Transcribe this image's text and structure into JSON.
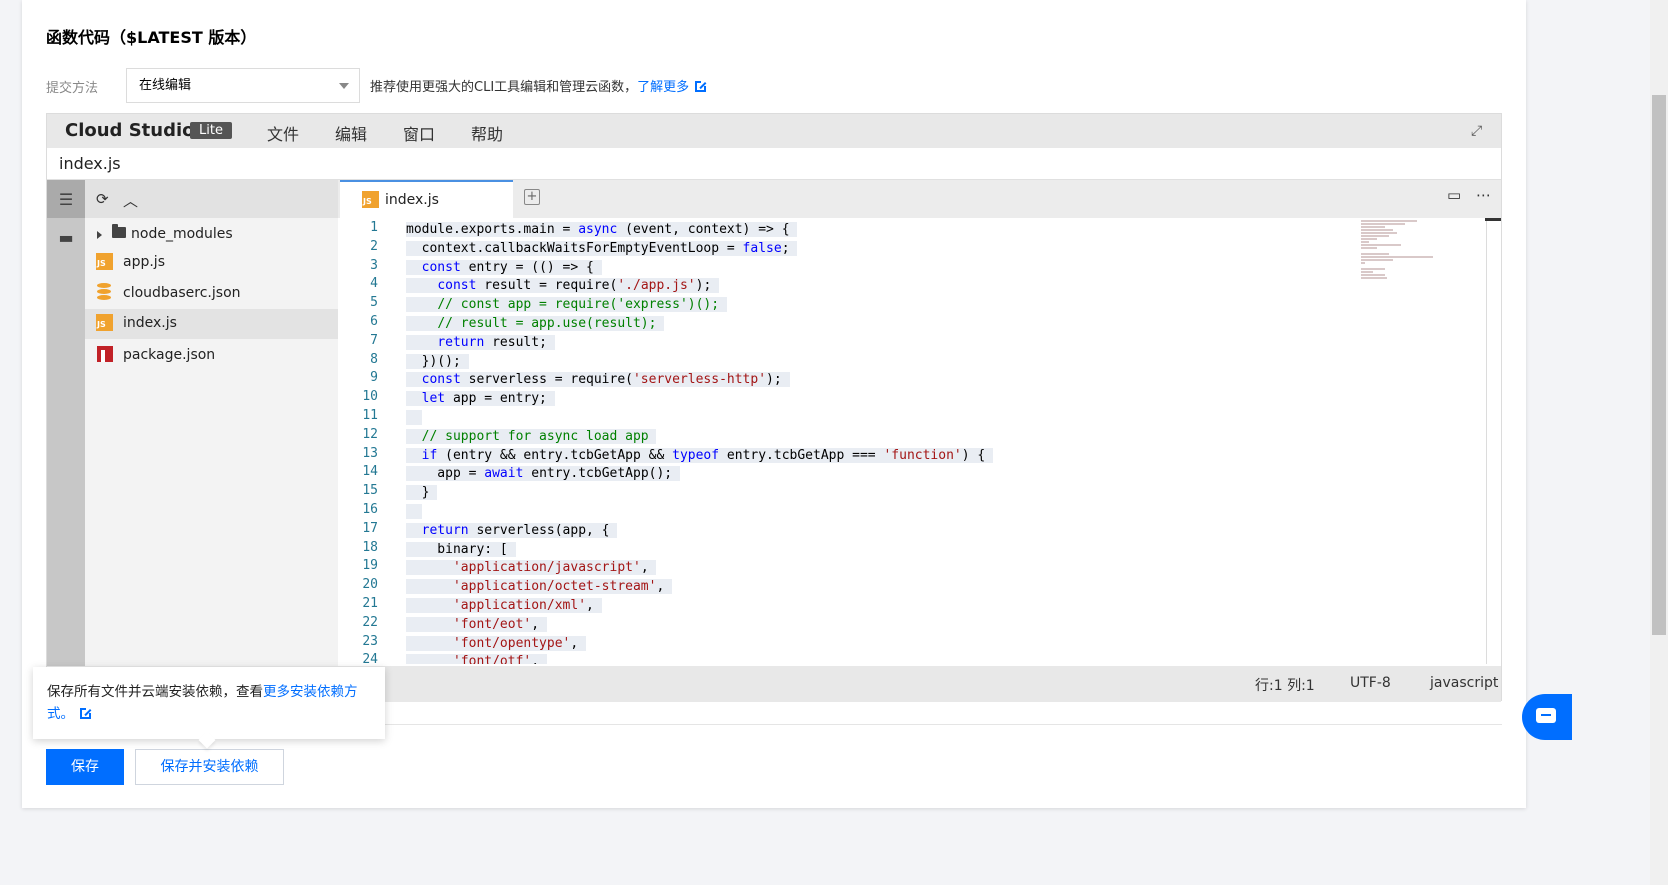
{
  "section": {
    "title": "函数代码（$LATEST 版本）"
  },
  "method": {
    "label": "提交方法",
    "selected": "在线编辑",
    "hint_text": "推荐使用更强大的CLI工具编辑和管理云函数，",
    "hint_link": "了解更多"
  },
  "ide": {
    "brand": "Cloud Studio",
    "brand_badge": "Lite",
    "menu": [
      "文件",
      "编辑",
      "窗口",
      "帮助"
    ],
    "file_title": "index.js",
    "tree": [
      {
        "name": "node_modules",
        "type": "folder"
      },
      {
        "name": "app.js",
        "type": "js"
      },
      {
        "name": "cloudbaserc.json",
        "type": "db"
      },
      {
        "name": "index.js",
        "type": "js",
        "active": true
      },
      {
        "name": "package.json",
        "type": "npm"
      }
    ],
    "tab": {
      "label": "index.js",
      "badge": "JS"
    },
    "status": {
      "position": "行:1 列:1",
      "encoding": "UTF-8",
      "language": "javascript"
    },
    "code": [
      "module.exports.main = async (event, context) => {",
      "  context.callbackWaitsForEmptyEventLoop = false;",
      "  const entry = (() => {",
      "    const result = require('./app.js');",
      "    // const app = require('express')();",
      "    // result = app.use(result);",
      "    return result;",
      "  })();",
      "  const serverless = require('serverless-http');",
      "  let app = entry;",
      "",
      "  // support for async load app",
      "  if (entry && entry.tcbGetApp && typeof entry.tcbGetApp === 'function') {",
      "    app = await entry.tcbGetApp();",
      "  }",
      "",
      "  return serverless(app, {",
      "    binary: [",
      "      'application/javascript',",
      "      'application/octet-stream',",
      "      'application/xml',",
      "      'font/eot',",
      "      'font/opentype',",
      "      'font/otf',"
    ]
  },
  "tooltip": {
    "text": "保存所有文件并云端安装依赖，查看",
    "link": "更多安装依赖方式。"
  },
  "buttons": {
    "save": "保存",
    "save_install": "保存并安装依赖"
  },
  "colors": {
    "primary": "#006eff",
    "keyword": "#0000ff",
    "string": "#a31515",
    "comment": "#008000",
    "linenum": "#237893"
  }
}
